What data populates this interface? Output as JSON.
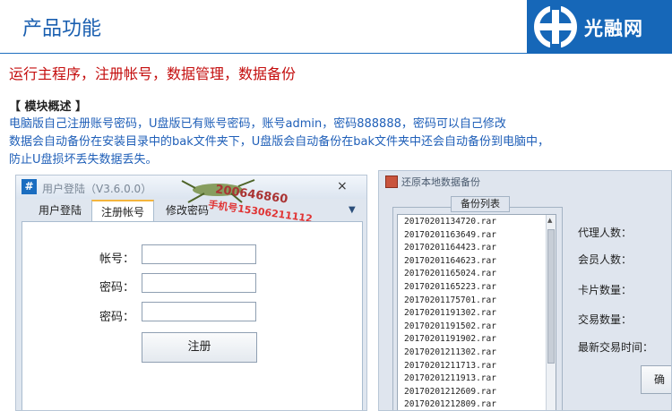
{
  "header": {
    "title": "产品功能",
    "logo_text": "光融网"
  },
  "intro": {
    "subtitle": "运行主程序，注册帐号，数据管理，数据备份",
    "section_heading": "【 模块概述 】",
    "lines": [
      "电脑版自己注册账号密码，U盘版已有账号密码，账号admin，密码888888，密码可以自己修改",
      "数据会自动备份在安装目录中的bak文件夹下，U盘版会自动备份在bak文件夹中还会自动备份到电脑中，",
      "防止U盘损坏丢失数据丢失。"
    ]
  },
  "login_window": {
    "title": "用户登陆（V3.6.0.0）",
    "icon_glyph": "#",
    "close_glyph": "×",
    "watermark_qq": "200646860",
    "watermark_phone": "手机号15306211112",
    "tabs": [
      "用户登陆",
      "注册帐号",
      "修改密码"
    ],
    "active_tab": "注册帐号",
    "dropdown_glyph": "▼",
    "fields": {
      "account_label": "帐号：",
      "password_label": "密码：",
      "confirm_label": "密码："
    },
    "register_button": "注册"
  },
  "backup_window": {
    "title": "还原本地数据备份",
    "group_title": "备份列表",
    "files": [
      "20170201134720.rar",
      "20170201163649.rar",
      "20170201164423.rar",
      "20170201164623.rar",
      "20170201165024.rar",
      "20170201165223.rar",
      "20170201175701.rar",
      "20170201191302.rar",
      "20170201191502.rar",
      "20170201191902.rar",
      "20170201211302.rar",
      "20170201211713.rar",
      "20170201211913.rar",
      "20170201212609.rar",
      "20170201212809.rar"
    ],
    "stats": {
      "agents": "代理人数：",
      "members": "会员人数：",
      "cards": "卡片数量：",
      "trades": "交易数量：",
      "last_trade": "最新交易时间："
    },
    "confirm_button": "确"
  },
  "colors": {
    "brand_blue": "#1667b8",
    "subtitle_red": "#c40d0d",
    "body_blue": "#1f5fb8"
  }
}
